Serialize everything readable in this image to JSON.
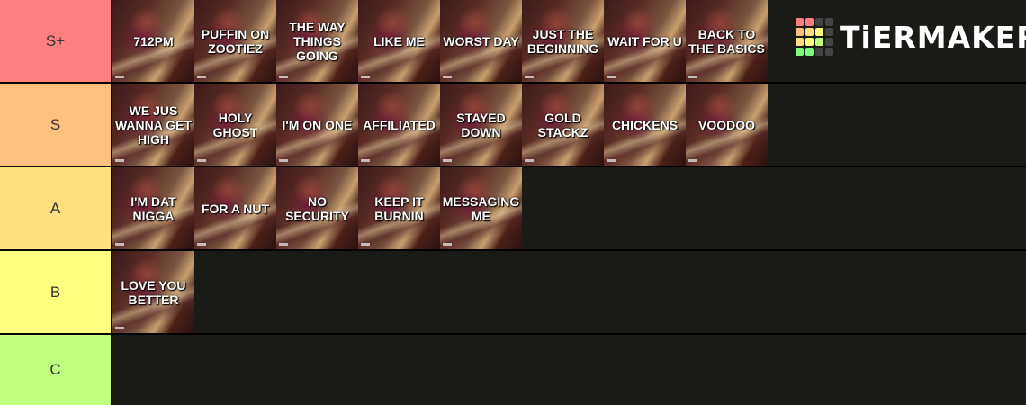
{
  "brand": {
    "name": "TiERMAKER",
    "grid_colors": [
      "#ff7f7f",
      "#ff7f7f",
      "#444444",
      "#444444",
      "#ffbf7f",
      "#ffdf7f",
      "#ffff7f",
      "#444444",
      "#ffdf7f",
      "#ffff7f",
      "#bfff7f",
      "#444444",
      "#7fff7f",
      "#7fff7f",
      "#444444",
      "#444444"
    ]
  },
  "tiers": [
    {
      "label": "S+",
      "color": "#ff7f7f",
      "items": [
        "712PM",
        "PUFFIN ON ZOOTIEZ",
        "THE WAY THINGS GOING",
        "LIKE ME",
        "WORST DAY",
        "JUST THE BEGINNING",
        "WAIT FOR U",
        "BACK TO THE BASICS"
      ]
    },
    {
      "label": "S",
      "color": "#ffbf7f",
      "items": [
        "WE JUS WANNA GET HIGH",
        "HOLY GHOST",
        "I'M ON ONE",
        "AFFILIATED",
        "STAYED DOWN",
        "GOLD STACKZ",
        "CHICKENS",
        "VOODOO"
      ]
    },
    {
      "label": "A",
      "color": "#ffdf7f",
      "items": [
        "I'M DAT NIGGA",
        "FOR A NUT",
        "NO SECURITY",
        "KEEP IT BURNIN",
        "MESSAGING ME"
      ]
    },
    {
      "label": "B",
      "color": "#ffff7f",
      "items": [
        "LOVE YOU BETTER"
      ]
    },
    {
      "label": "C",
      "color": "#bfff7f",
      "items": []
    }
  ]
}
